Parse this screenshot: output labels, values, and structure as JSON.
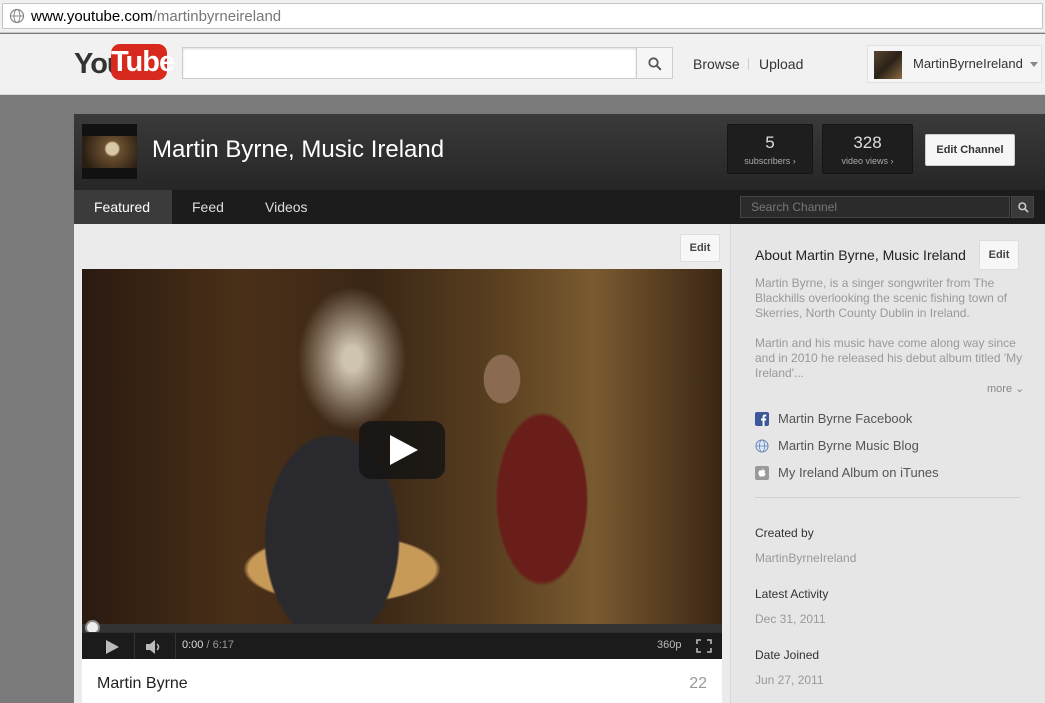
{
  "browser": {
    "url_host": "www.youtube.com",
    "url_path": "/martinbyrneireland"
  },
  "header": {
    "logo_you": "You",
    "logo_tube": "Tube",
    "search_placeholder": "",
    "browse": "Browse",
    "upload": "Upload",
    "username": "MartinByrneIreland"
  },
  "channel": {
    "title": "Martin Byrne, Music Ireland",
    "subscribers_count": "5",
    "subscribers_label": "subscribers ›",
    "views_count": "328",
    "views_label": "video views ›",
    "edit_channel": "Edit Channel",
    "tabs": [
      {
        "label": "Featured"
      },
      {
        "label": "Feed"
      },
      {
        "label": "Videos"
      }
    ],
    "search_placeholder": "Search Channel"
  },
  "main": {
    "edit_label": "Edit",
    "player": {
      "time_current": "0:00",
      "time_sep": " / ",
      "time_total": "6:17",
      "quality": "360p",
      "progress": 0
    },
    "video_title": "Martin Byrne",
    "video_views": "22"
  },
  "sidebar": {
    "about_title": "About Martin Byrne, Music Ireland",
    "edit_label": "Edit",
    "about_p1": "Martin Byrne, is a singer songwriter from The Blackhills overlooking the scenic fishing town of Skerries, North County Dublin in Ireland.",
    "about_p2": "Martin and his music have come along way since and in 2010 he released his debut album titled 'My Ireland'...",
    "more": "more",
    "links": [
      {
        "icon": "facebook-icon",
        "label": "Martin Byrne Facebook"
      },
      {
        "icon": "globe-icon",
        "label": "Martin Byrne Music Blog"
      },
      {
        "icon": "apple-icon",
        "label": "My Ireland Album on iTunes"
      }
    ],
    "created_by_label": "Created by",
    "created_by_value": "MartinByrneIreland",
    "latest_activity_label": "Latest Activity",
    "latest_activity_value": "Dec 31, 2011",
    "date_joined_label": "Date Joined",
    "date_joined_value": "Jun 27, 2011"
  },
  "colors": {
    "logo_red": "#d8291f",
    "channel_bar": "#2e2e2e",
    "facebook_blue": "#3b5998"
  }
}
